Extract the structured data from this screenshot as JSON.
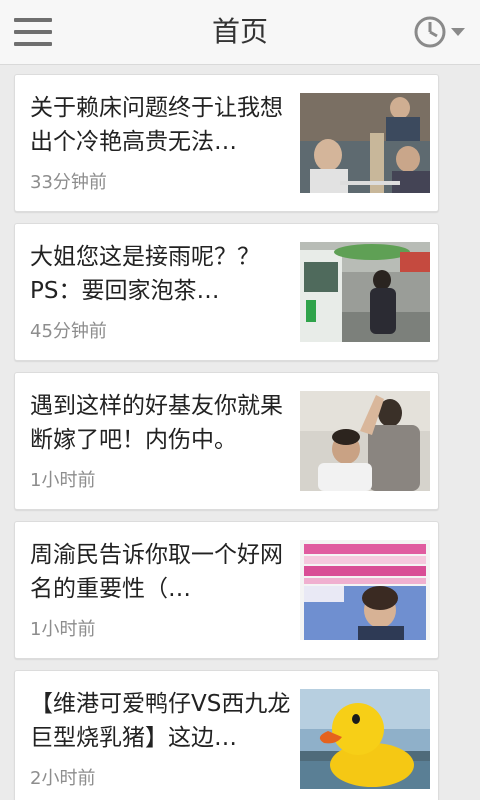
{
  "header": {
    "title": "首页",
    "menu_icon": "menu-icon",
    "history_icon": "clock-icon"
  },
  "feed": {
    "items": [
      {
        "title": "关于赖床问题终于让我想出个冷艳高贵无法…",
        "time": "33分钟前",
        "thumb": "video-thumbnail"
      },
      {
        "title": "大姐您这是接雨呢？？PS：要回家泡茶…",
        "time": "45分钟前",
        "thumb": "umbrella-photo"
      },
      {
        "title": "遇到这样的好基友你就果断嫁了吧！内伤中。",
        "time": "1小时前",
        "thumb": "friends-photo"
      },
      {
        "title": "周渝民告诉你取一个好网名的重要性（…",
        "time": "1小时前",
        "thumb": "tv-show-thumbnail"
      },
      {
        "title": "【维港可爱鸭仔VS西九龙巨型烧乳猪】这边…",
        "time": "2小时前",
        "thumb": "rubber-duck-photo"
      }
    ]
  },
  "colors": {
    "background": "#ebebeb",
    "card": "#ffffff",
    "title_text": "#222222",
    "time_text": "#8d8d8d",
    "icon_gray": "#6f6f6f"
  }
}
